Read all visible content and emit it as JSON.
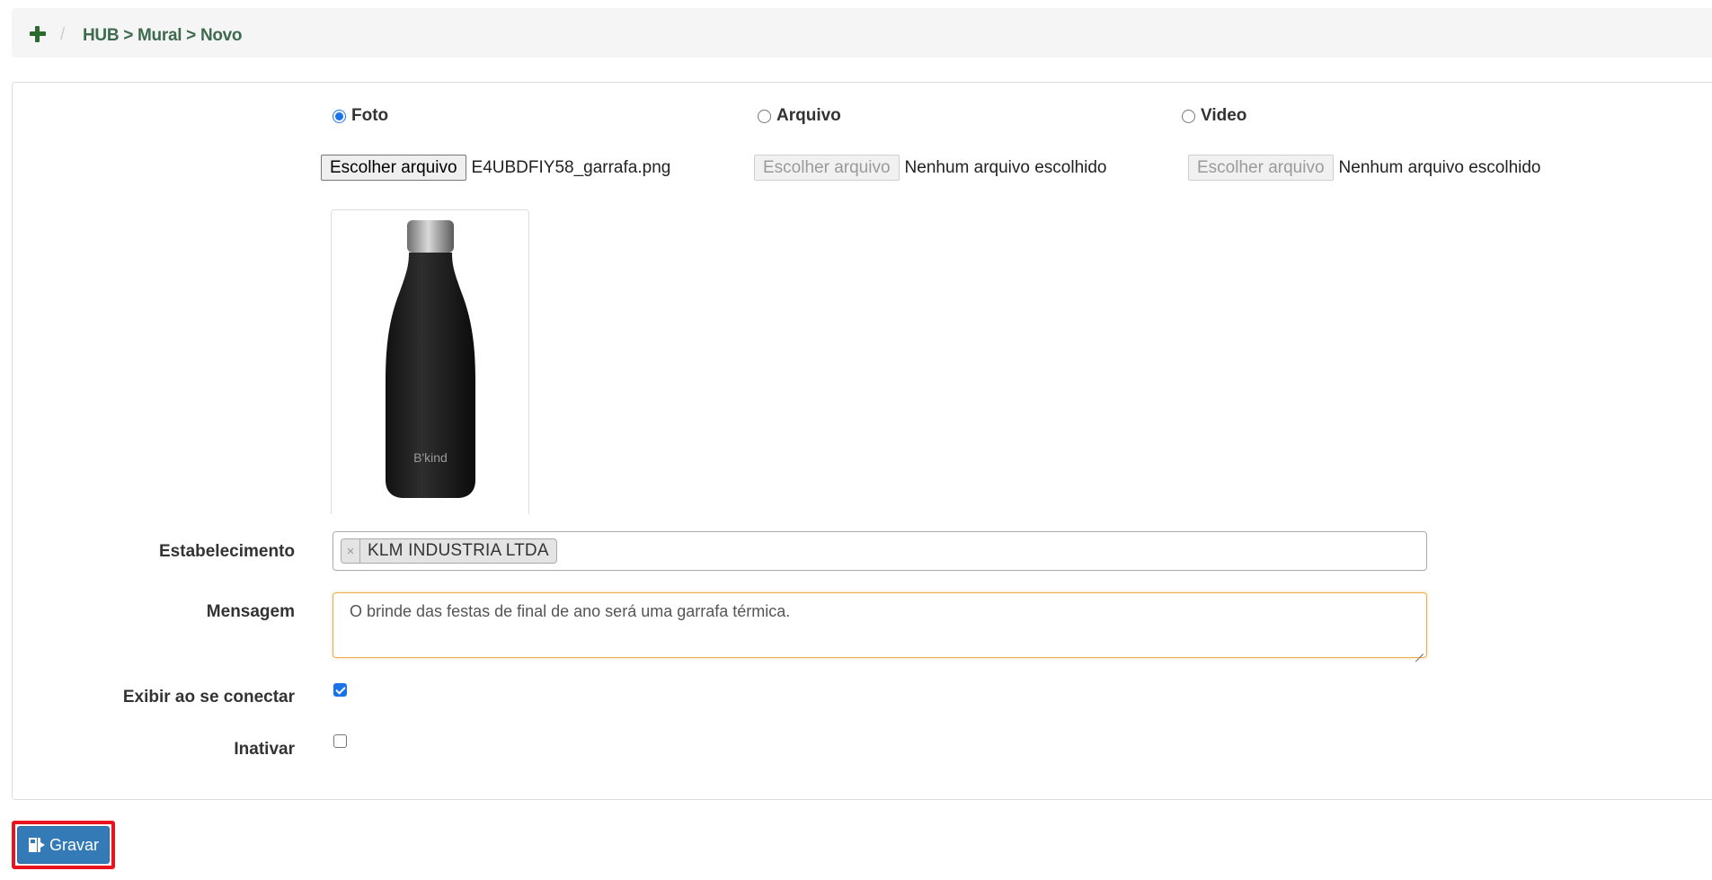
{
  "breadcrumb": {
    "separator": "/",
    "path": "HUB > Mural > Novo",
    "icon": "plus-icon"
  },
  "media_type": {
    "options": [
      {
        "label": "Foto",
        "selected": true
      },
      {
        "label": "Arquivo",
        "selected": false
      },
      {
        "label": "Video",
        "selected": false
      }
    ]
  },
  "file_inputs": [
    {
      "button_label": "Escolher arquivo",
      "file_name": "E4UBDFIY58_garrafa.png",
      "disabled": false
    },
    {
      "button_label": "Escolher arquivo",
      "file_name": "Nenhum arquivo escolhido",
      "disabled": true
    },
    {
      "button_label": "Escolher arquivo",
      "file_name": "Nenhum arquivo escolhido",
      "disabled": true
    }
  ],
  "preview": {
    "brand_text": "B'kind",
    "bottle_color": "#1f1f1f",
    "cap_color": "#9a9a9a"
  },
  "form": {
    "estabelecimento": {
      "label": "Estabelecimento",
      "tag_remove": "×",
      "tag_text": "KLM INDUSTRIA LTDA"
    },
    "mensagem": {
      "label": "Mensagem",
      "value": "O brinde das festas de final de ano será uma garrafa térmica."
    },
    "exibir": {
      "label": "Exibir ao se conectar",
      "checked": true
    },
    "inativar": {
      "label": "Inativar",
      "checked": false
    }
  },
  "actions": {
    "save_label": "Gravar",
    "save_icon": "save-icon"
  },
  "colors": {
    "accent": "#337ab7",
    "highlight": "#e8141e",
    "breadcrumb_text": "#3e6b4e",
    "textarea_focus": "#f0ad4e"
  }
}
